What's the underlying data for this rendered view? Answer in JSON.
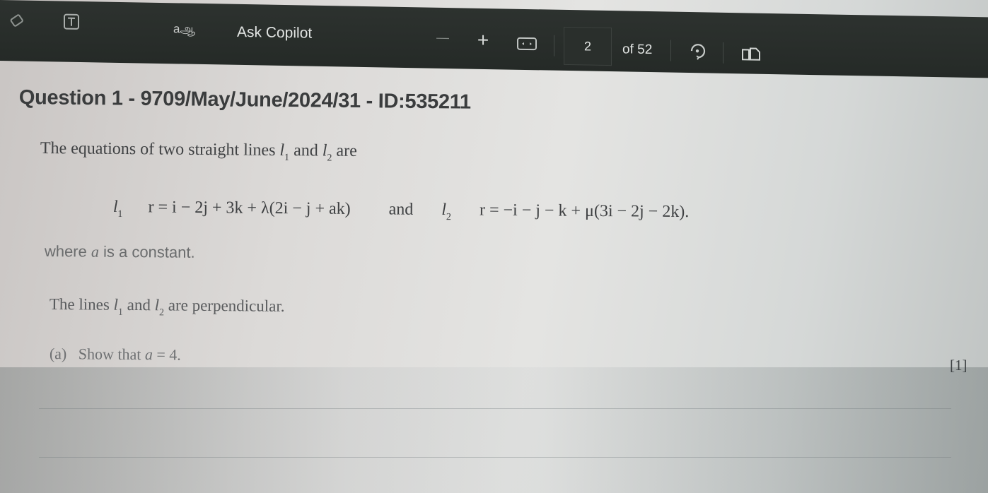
{
  "toolbar": {
    "icons": {
      "draw": "eraser-icon",
      "text": "text-box-icon",
      "read_aloud": "read-aloud-icon",
      "zoom_out": "minus-icon",
      "zoom_in": "plus-icon",
      "fit": "fit-width-icon",
      "rotate": "rotate-icon",
      "view": "two-page-view-icon"
    },
    "read_aloud_label": "aஆ",
    "ask_copilot_label": "Ask Copilot",
    "zoom_out_glyph": "—",
    "zoom_in_glyph": "+",
    "page_current": "2",
    "page_total_label": "of 52"
  },
  "document": {
    "question_title": "Question 1 - 9709/May/June/2024/31 - ID:535211",
    "intro": {
      "before": "The equations of two straight lines ",
      "l": "l",
      "sub1": "1",
      "mid": " and ",
      "sub2": "2",
      "after": " are"
    },
    "equations": {
      "line1_label": "l",
      "line1_sub": "1",
      "line1_eq": "r = i − 2j + 3k + λ(2i − j + ak)",
      "joiner": "and",
      "line2_label": "l",
      "line2_sub": "2",
      "line2_eq": "r = −i − j − k + μ(3i − 2j − 2k)."
    },
    "where_text": {
      "before": "where ",
      "var": "a",
      "after": " is a constant."
    },
    "perpendicular_text": {
      "before": "The lines ",
      "sub1": "1",
      "mid": " and ",
      "sub2": "2",
      "after": " are perpendicular."
    },
    "part_a": {
      "label": "(a)",
      "before": "Show that ",
      "var": "a",
      "after": " = 4."
    },
    "marks": "[1]"
  }
}
